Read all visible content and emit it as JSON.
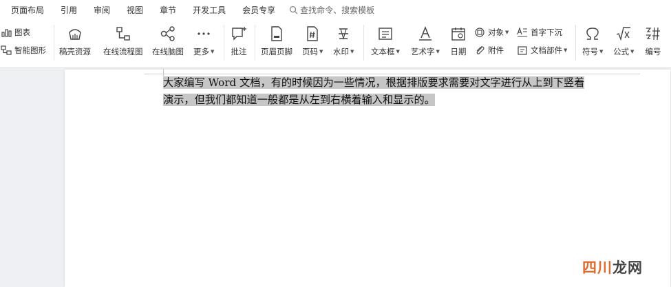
{
  "menu": {
    "items": [
      "页面布局",
      "引用",
      "审阅",
      "视图",
      "章节",
      "开发工具",
      "会员专享"
    ],
    "search_label": "查找命令、搜索模板"
  },
  "ribbon": {
    "chart_label": "图表",
    "smartart_label": "智能图形",
    "resources_label": "稿壳资源",
    "flowchart_label": "在线流程图",
    "mindmap_label": "在线脑图",
    "more_label": "更多",
    "comment_label": "批注",
    "header_footer_label": "页眉页脚",
    "page_number_label": "页码",
    "watermark_label": "水印",
    "textbox_label": "文本框",
    "wordart_label": "艺术字",
    "date_label": "日期",
    "object_label": "对象",
    "attachment_label": "附件",
    "dropcap_label": "首字下沉",
    "docparts_label": "文档部件",
    "symbol_label": "符号",
    "formula_label": "公式",
    "numbering_label": "编号"
  },
  "document": {
    "line1": "大家编写 Word 文档，有的时候因为一些情况，根据排版要求需要对文字进行从上到下竖着",
    "line2": "演示，但我们都知道一般都是从左到右横着输入和显示的。"
  },
  "watermark": {
    "part1": "四川",
    "part2": "龙网"
  },
  "colors": {
    "selection": "#c6c6c6",
    "watermark_orange": "#e06a2c",
    "watermark_dark": "#444444"
  }
}
